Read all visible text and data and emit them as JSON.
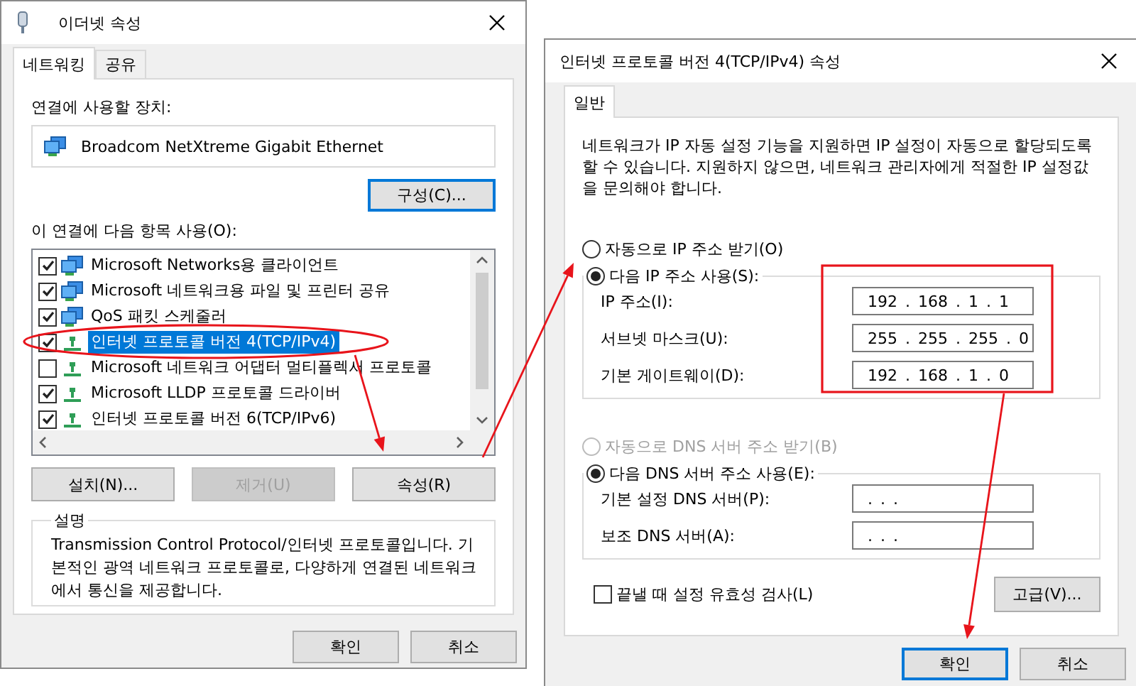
{
  "ethernet_dialog": {
    "title": "이더넷 속성",
    "tabs": [
      {
        "label": "네트워킹",
        "selected": true
      },
      {
        "label": "공유",
        "selected": false
      }
    ],
    "device_label": "연결에 사용할 장치:",
    "device_name": "Broadcom NetXtreme Gigabit Ethernet",
    "configure_button": {
      "label": "구성(C)...",
      "default": true
    },
    "items_label": "이 연결에 다음 항목 사용(O):",
    "items": [
      {
        "label": "Microsoft Networks용 클라이언트",
        "kind": "monitor",
        "checked": true,
        "selected": false
      },
      {
        "label": "Microsoft 네트워크용 파일 및 프린터 공유",
        "kind": "monitor",
        "checked": true,
        "selected": false
      },
      {
        "label": "QoS 패킷 스케줄러",
        "kind": "monitor",
        "checked": true,
        "selected": false
      },
      {
        "label": "인터넷 프로토콜 버전 4(TCP/IPv4)",
        "kind": "protocol",
        "checked": true,
        "selected": true
      },
      {
        "label": "Microsoft 네트워크 어댑터 멀티플렉서 프로토콜",
        "kind": "protocol",
        "checked": false,
        "selected": false
      },
      {
        "label": "Microsoft LLDP 프로토콜 드라이버",
        "kind": "protocol",
        "checked": true,
        "selected": false
      },
      {
        "label": "인터넷 프로토콜 버전 6(TCP/IPv6)",
        "kind": "protocol",
        "checked": true,
        "selected": false
      }
    ],
    "item_buttons": [
      {
        "label": "설치(N)...",
        "disabled": false
      },
      {
        "label": "제거(U)",
        "disabled": true
      },
      {
        "label": "속성(R)",
        "disabled": false
      }
    ],
    "description_title": "설명",
    "description": "Transmission Control Protocol/인터넷 프로토콜입니다. 기본적인 광역 네트워크 프로토콜로, 다양하게 연결된 네트워크에서 통신을 제공합니다.",
    "footer_buttons": [
      {
        "label": "확인",
        "default": false
      },
      {
        "label": "취소",
        "default": false
      }
    ]
  },
  "ipv4_dialog": {
    "title": "인터넷 프로토콜 버전 4(TCP/IPv4) 속성",
    "tabs": [
      {
        "label": "일반",
        "selected": true
      }
    ],
    "intro": "네트워크가 IP 자동 설정 기능을 지원하면 IP 설정이 자동으로 할당되도록 할 수 있습니다. 지원하지 않으면, 네트워크 관리자에게 적절한 IP 설정값을 문의해야 합니다.",
    "ip_options": [
      {
        "label": "자동으로 IP 주소 받기(O)",
        "selected": false,
        "disabled": false
      },
      {
        "label": "다음 IP 주소 사용(S):",
        "selected": true,
        "disabled": false
      }
    ],
    "ip_fields": [
      {
        "label": "IP 주소(I):",
        "value": "192 . 168 . 1 . 1"
      },
      {
        "label": "서브넷 마스크(U):",
        "value": "255 . 255 . 255 . 0"
      },
      {
        "label": "기본 게이트웨이(D):",
        "value": "192 . 168 . 1 . 0"
      }
    ],
    "dns_options": [
      {
        "label": "자동으로 DNS 서버 주소 받기(B)",
        "selected": false,
        "disabled": true
      },
      {
        "label": "다음 DNS 서버 주소 사용(E):",
        "selected": true,
        "disabled": false
      }
    ],
    "dns_fields": [
      {
        "label": "기본 설정 DNS 서버(P):",
        "value": ". . ."
      },
      {
        "label": "보조 DNS 서버(A):",
        "value": ". . ."
      }
    ],
    "validate": {
      "label": "끝낼 때 설정 유효성 검사(L)",
      "checked": false
    },
    "advanced_button": {
      "label": "고급(V)...",
      "default": false
    },
    "footer_buttons": [
      {
        "label": "확인",
        "default": true
      },
      {
        "label": "취소",
        "default": false
      }
    ]
  }
}
